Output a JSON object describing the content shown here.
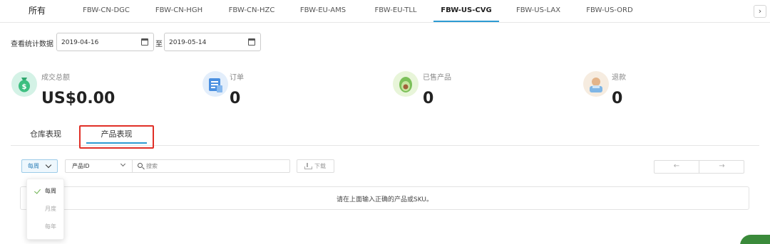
{
  "tabs": {
    "all": "所有",
    "items": [
      "FBW-CN-DGC",
      "FBW-CN-HGH",
      "FBW-CN-HZC",
      "FBW-EU-AMS",
      "FBW-EU-TLL",
      "FBW-US-CVG",
      "FBW-US-LAX",
      "FBW-US-ORD"
    ],
    "active": "FBW-US-CVG",
    "scroll_icon": "chevron-right-icon"
  },
  "date_range": {
    "label": "查看统计数据",
    "start": "2019-04-16",
    "separator": "至",
    "end": "2019-05-14"
  },
  "stats": [
    {
      "label": "成交总额",
      "value": "US$0.00",
      "icon": "money-bag-icon"
    },
    {
      "label": "订单",
      "value": "0",
      "icon": "order-document-icon"
    },
    {
      "label": "已售产品",
      "value": "0",
      "icon": "product-avocado-icon"
    },
    {
      "label": "退款",
      "value": "0",
      "icon": "refund-person-icon"
    }
  ],
  "sub_tabs": {
    "warehouse": "仓库表现",
    "product": "产品表现",
    "active": "产品表现"
  },
  "toolbar": {
    "period_selected": "每周",
    "field_selected": "产品ID",
    "search_placeholder": "搜索",
    "download_label": "下载",
    "prev_arrow": "←",
    "next_arrow": "→"
  },
  "period_menu": [
    {
      "label": "每周",
      "selected": true
    },
    {
      "label": "月度",
      "selected": false
    },
    {
      "label": "每年",
      "selected": false
    }
  ],
  "message": "请在上面输入正确的产品或SKU。",
  "colors": {
    "accent": "#2d9bd3",
    "highlight_box": "#e02f26",
    "check": "#6ab04c"
  }
}
